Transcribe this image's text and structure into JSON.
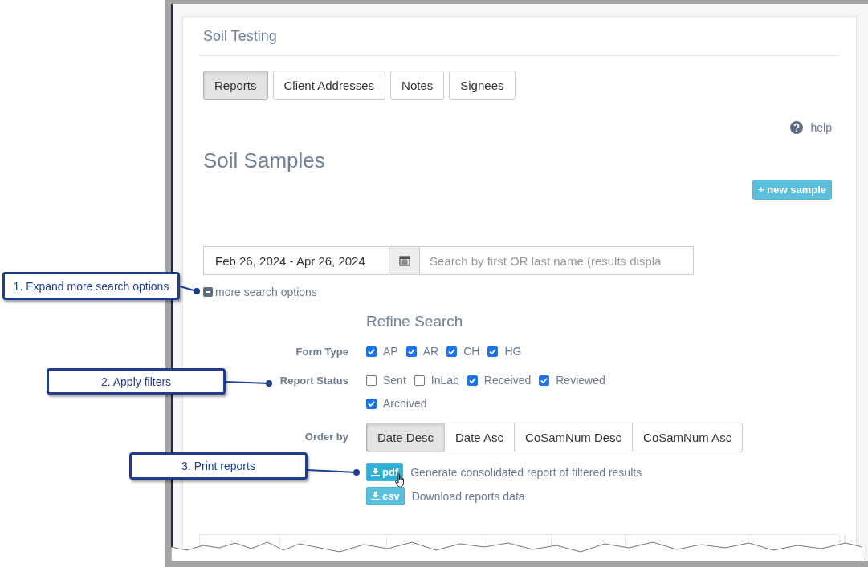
{
  "panel": {
    "title": "Soil Testing"
  },
  "tabs": [
    {
      "label": "Reports",
      "selected": true
    },
    {
      "label": "Client Addresses",
      "selected": false
    },
    {
      "label": "Notes",
      "selected": false
    },
    {
      "label": "Signees",
      "selected": false
    }
  ],
  "help": {
    "label": "help"
  },
  "heading": "Soil Samples",
  "new_sample_button": {
    "label": "+ new sample"
  },
  "date_range": {
    "value": "Feb 26, 2024 - Apr 26, 2024"
  },
  "search": {
    "placeholder": "Search by first OR last name (results displa"
  },
  "more_options": {
    "label": "more search options",
    "expanded": true
  },
  "refine": {
    "title": "Refine Search",
    "groups": [
      {
        "label": "Form Type",
        "options": [
          {
            "label": "AP",
            "checked": true
          },
          {
            "label": "AR",
            "checked": true
          },
          {
            "label": "CH",
            "checked": true
          },
          {
            "label": "HG",
            "checked": true
          }
        ]
      },
      {
        "label": "Report Status",
        "options": [
          {
            "label": "Sent",
            "checked": false
          },
          {
            "label": "InLab",
            "checked": false
          },
          {
            "label": "Received",
            "checked": true
          },
          {
            "label": "Reviewed",
            "checked": true
          },
          {
            "label": "Archived",
            "checked": true
          }
        ]
      }
    ]
  },
  "order_by": {
    "label": "Order by",
    "options": [
      {
        "label": "Date Desc",
        "selected": true
      },
      {
        "label": "Date Asc",
        "selected": false
      },
      {
        "label": "CoSamNum Desc",
        "selected": false
      },
      {
        "label": "CoSamNum Asc",
        "selected": false
      }
    ]
  },
  "downloads": [
    {
      "label": "pdf",
      "description": "Generate consolidated report of filtered results"
    },
    {
      "label": "csv",
      "description": "Download reports data"
    }
  ],
  "callouts": [
    {
      "label": "1. Expand more search options"
    },
    {
      "label": "2. Apply filters"
    },
    {
      "label": "3. Print reports"
    }
  ]
}
